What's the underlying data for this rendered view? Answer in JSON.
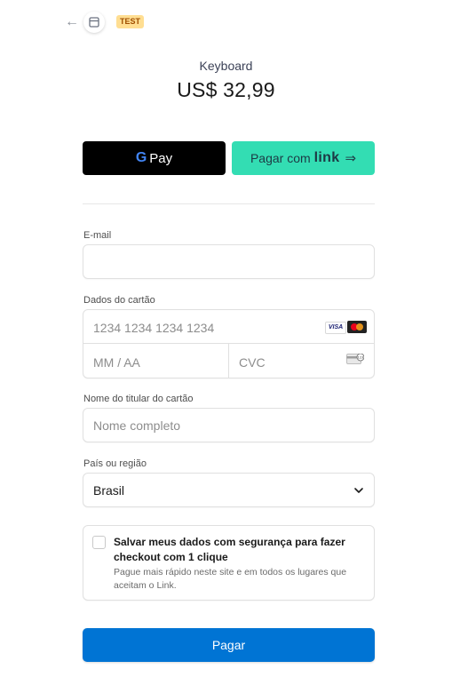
{
  "header": {
    "back_icon": "arrow-left-icon",
    "store_icon": "store-icon",
    "test_badge": "TEST"
  },
  "product": {
    "name": "Keyboard",
    "price": "US$ 32,99"
  },
  "express": {
    "gpay_g": "G",
    "gpay_label": "Pay",
    "link_prefix": "Pagar com",
    "link_brand": "link",
    "link_arrow": "⇒"
  },
  "form": {
    "email_label": "E-mail",
    "email_value": "",
    "card_label": "Dados do cartão",
    "card_number_placeholder": "1234 1234 1234 1234",
    "visa_text": "VISA",
    "expiry_placeholder": "MM / AA",
    "cvc_placeholder": "CVC",
    "cvc_badge": "123",
    "name_label": "Nome do titular do cartão",
    "name_placeholder": "Nome completo",
    "country_label": "País ou região",
    "country_value": "Brasil",
    "save_title": "Salvar meus dados com segurança para fazer checkout com 1 clique",
    "save_description": "Pague mais rápido neste site e em todos os lugares que aceitam o Link.",
    "save_checked": false
  },
  "submit": {
    "label": "Pagar",
    "color": "#0074d4"
  },
  "colors": {
    "link_green": "#33ddb3",
    "test_badge_bg": "#ffde92"
  }
}
